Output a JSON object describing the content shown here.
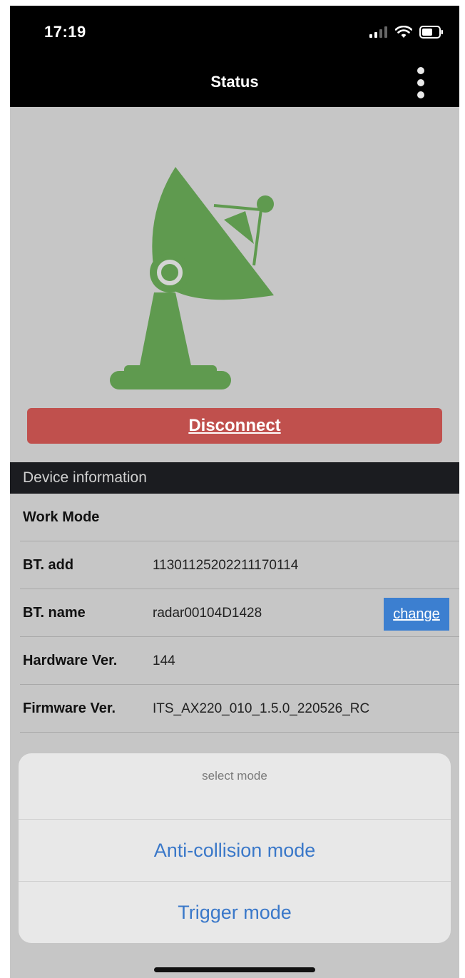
{
  "status_bar": {
    "time": "17:19"
  },
  "nav": {
    "title": "Status"
  },
  "actions": {
    "disconnect_label": "Disconnect"
  },
  "device_info": {
    "section_title": "Device information",
    "rows": [
      {
        "label": "Work Mode",
        "value": ""
      },
      {
        "label": "BT. add",
        "value": "11301125202211170114"
      },
      {
        "label": "BT. name",
        "value": "radar00104D1428"
      },
      {
        "label": "Hardware Ver.",
        "value": "144"
      },
      {
        "label": "Firmware Ver.",
        "value": "ITS_AX220_010_1.5.0_220526_RC"
      }
    ],
    "change_label": "change"
  },
  "select_sheet": {
    "title": "select mode",
    "options": [
      "Anti-collision mode",
      "Trigger mode"
    ]
  },
  "colors": {
    "radar_green": "#5f9a4f",
    "disconnect_red": "#c0504d",
    "content_bg": "#c6c6c6",
    "header_dark": "#1b1c20",
    "change_blue": "#3c7fd0",
    "sheet_option_blue": "#3a78c9"
  }
}
